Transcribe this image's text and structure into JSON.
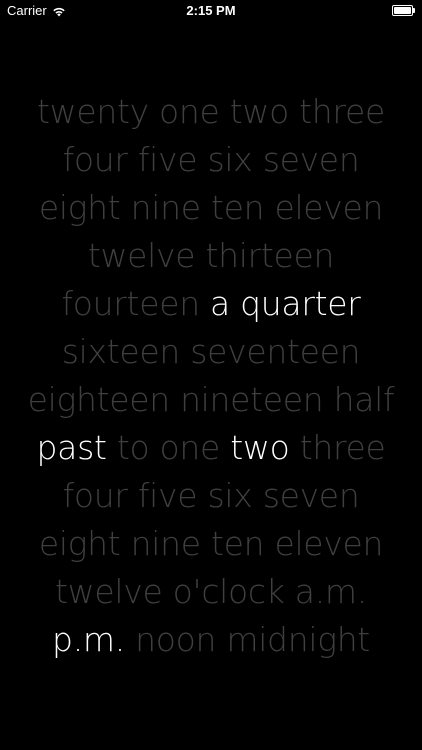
{
  "status_bar": {
    "carrier": "Carrier",
    "time": "2:15 PM",
    "wifi_icon": "wifi-icon",
    "battery_icon": "battery-icon"
  },
  "colors": {
    "background": "#000000",
    "word_dim": "#3f3f3f",
    "word_lit": "#ffffff"
  },
  "clock_face": {
    "lines": [
      {
        "words": [
          {
            "text": "twenty",
            "lit": false
          },
          {
            "text": "one",
            "lit": false
          },
          {
            "text": "two",
            "lit": false
          },
          {
            "text": "three",
            "lit": false
          }
        ]
      },
      {
        "words": [
          {
            "text": "four",
            "lit": false
          },
          {
            "text": "five",
            "lit": false
          },
          {
            "text": "six",
            "lit": false
          },
          {
            "text": "seven",
            "lit": false
          }
        ]
      },
      {
        "words": [
          {
            "text": "eight",
            "lit": false
          },
          {
            "text": "nine",
            "lit": false
          },
          {
            "text": "ten",
            "lit": false
          },
          {
            "text": "eleven",
            "lit": false
          }
        ]
      },
      {
        "words": [
          {
            "text": "twelve",
            "lit": false
          },
          {
            "text": "thirteen",
            "lit": false
          }
        ]
      },
      {
        "words": [
          {
            "text": "fourteen",
            "lit": false
          },
          {
            "text": "a quarter",
            "lit": true
          }
        ]
      },
      {
        "words": [
          {
            "text": "sixteen",
            "lit": false
          },
          {
            "text": "seventeen",
            "lit": false
          }
        ]
      },
      {
        "words": [
          {
            "text": "eighteen",
            "lit": false
          },
          {
            "text": "nineteen",
            "lit": false
          },
          {
            "text": "half",
            "lit": false
          }
        ]
      },
      {
        "words": [
          {
            "text": "past",
            "lit": true
          },
          {
            "text": "to",
            "lit": false
          },
          {
            "text": "one",
            "lit": false
          },
          {
            "text": "two",
            "lit": true
          },
          {
            "text": "three",
            "lit": false
          }
        ]
      },
      {
        "words": [
          {
            "text": "four",
            "lit": false
          },
          {
            "text": "five",
            "lit": false
          },
          {
            "text": "six",
            "lit": false
          },
          {
            "text": "seven",
            "lit": false
          }
        ]
      },
      {
        "words": [
          {
            "text": "eight",
            "lit": false
          },
          {
            "text": "nine",
            "lit": false
          },
          {
            "text": "ten",
            "lit": false
          },
          {
            "text": "eleven",
            "lit": false
          }
        ]
      },
      {
        "words": [
          {
            "text": "twelve",
            "lit": false
          },
          {
            "text": "o'clock",
            "lit": false
          },
          {
            "text": "a.m.",
            "lit": false
          }
        ]
      },
      {
        "words": [
          {
            "text": "p.m.",
            "lit": true
          },
          {
            "text": "noon",
            "lit": false
          },
          {
            "text": "midnight",
            "lit": false
          }
        ]
      }
    ]
  }
}
